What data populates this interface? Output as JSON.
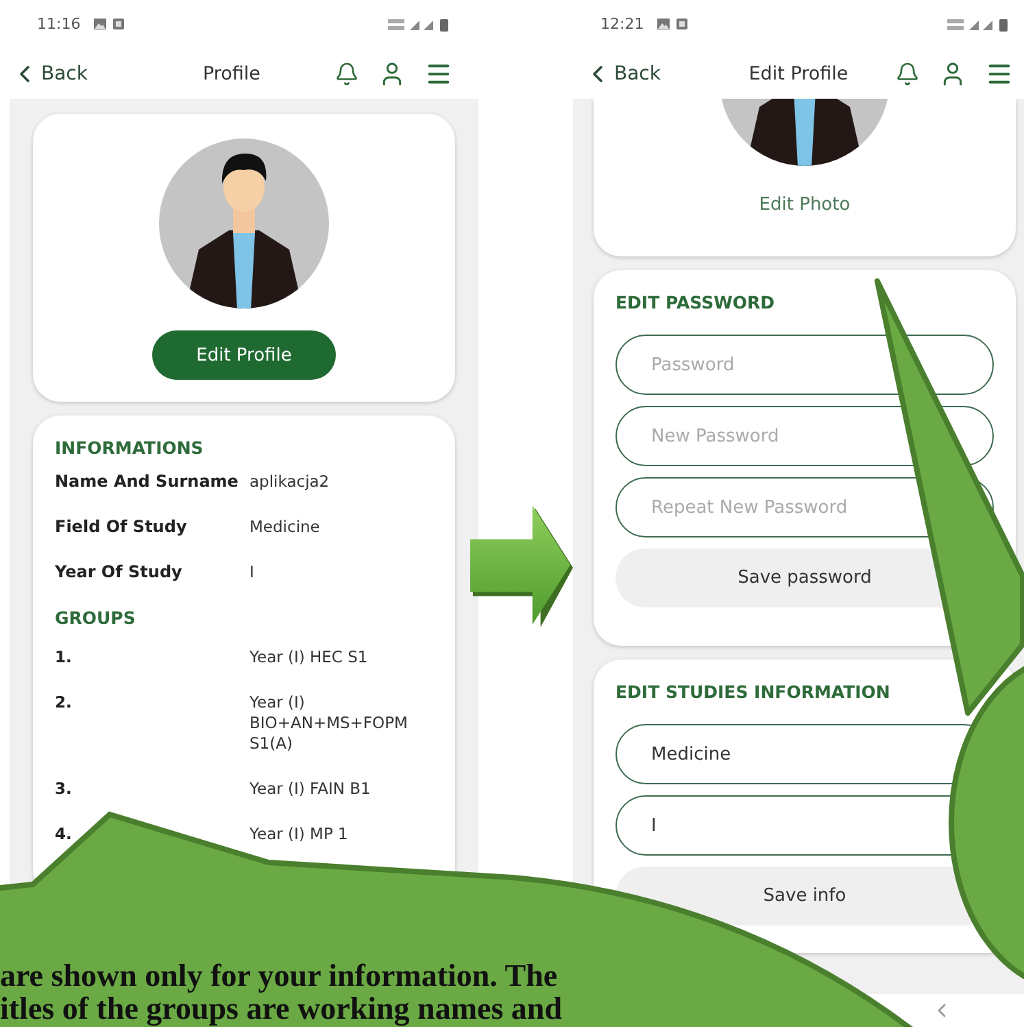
{
  "profile_screen": {
    "status_bar": {
      "time": "11:16"
    },
    "header": {
      "back": "Back",
      "title": "Profile"
    },
    "profile_card": {
      "button": "Edit Profile"
    },
    "info_card": {
      "title": "INFORMATIONS",
      "fields": [
        {
          "label": "Name And Surname",
          "value": "aplikacja2"
        },
        {
          "label": "Field Of Study",
          "value": "Medicine"
        },
        {
          "label": "Year Of Study",
          "value": "I"
        }
      ],
      "groups_title": "GROUPS",
      "groups": [
        {
          "number": "1.",
          "name": "Year (I) HEC S1"
        },
        {
          "number": "2.",
          "name": "Year (I) BIO+AN+MS+FOPM S1(A)"
        },
        {
          "number": "3.",
          "name": "Year (I) FAIN B1"
        },
        {
          "number": "4.",
          "name": "Year (I) MP 1"
        }
      ]
    }
  },
  "edit_profile_screen": {
    "status_bar": {
      "time": "12:21"
    },
    "header": {
      "back": "Back",
      "title": "Edit Profile"
    },
    "photo_card": {
      "link": "Edit Photo"
    },
    "password_card": {
      "title": "EDIT PASSWORD",
      "fields": [
        {
          "placeholder": "Password"
        },
        {
          "placeholder": "New Password"
        },
        {
          "placeholder": "Repeat New Password"
        }
      ],
      "button": "Save password"
    },
    "studies_card": {
      "title": "EDIT STUDIES INFORMATION",
      "fields": [
        {
          "value": "Medicine"
        },
        {
          "value": "I"
        }
      ],
      "button": "Save info"
    }
  },
  "callout": {
    "text": "are shown only for your information. The\nitles of the groups are working names and"
  }
}
